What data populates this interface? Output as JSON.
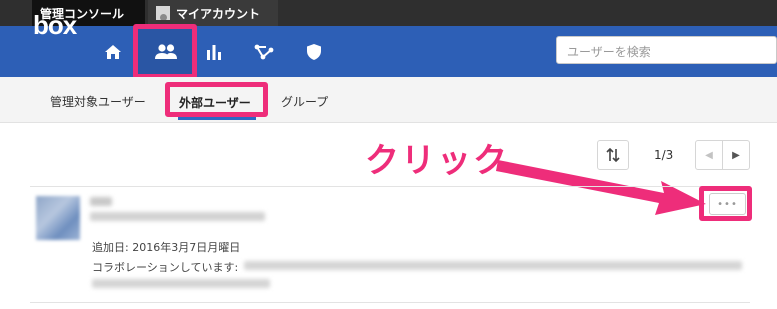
{
  "topbar": {
    "console_label": "管理コンソール",
    "account_label": "マイアカウント"
  },
  "navbar": {
    "logo": "box",
    "icons": [
      "home-icon",
      "users-icon",
      "bar-chart-icon",
      "workflow-icon",
      "shield-icon"
    ],
    "active": "users-icon",
    "search_placeholder": "ユーザーを検索"
  },
  "subnav": {
    "items": [
      {
        "label": "管理対象ユーザー"
      },
      {
        "label": "外部ユーザー"
      },
      {
        "label": "グループ"
      }
    ],
    "active_index": 1
  },
  "toolbar": {
    "page_indicator": "1/3",
    "prev_label": "◀",
    "next_label": "▶"
  },
  "annotation": {
    "label": "クリック",
    "color": "#ee2d7a"
  },
  "row": {
    "added_date": "追加日: 2016年3月7日月曜日",
    "collab_label": "コラボレーションしています:",
    "more_label": "•••"
  },
  "colors": {
    "navbar": "#2d5fb6",
    "highlight": "#ee2d7a",
    "topbar": "#2f2f2f"
  }
}
